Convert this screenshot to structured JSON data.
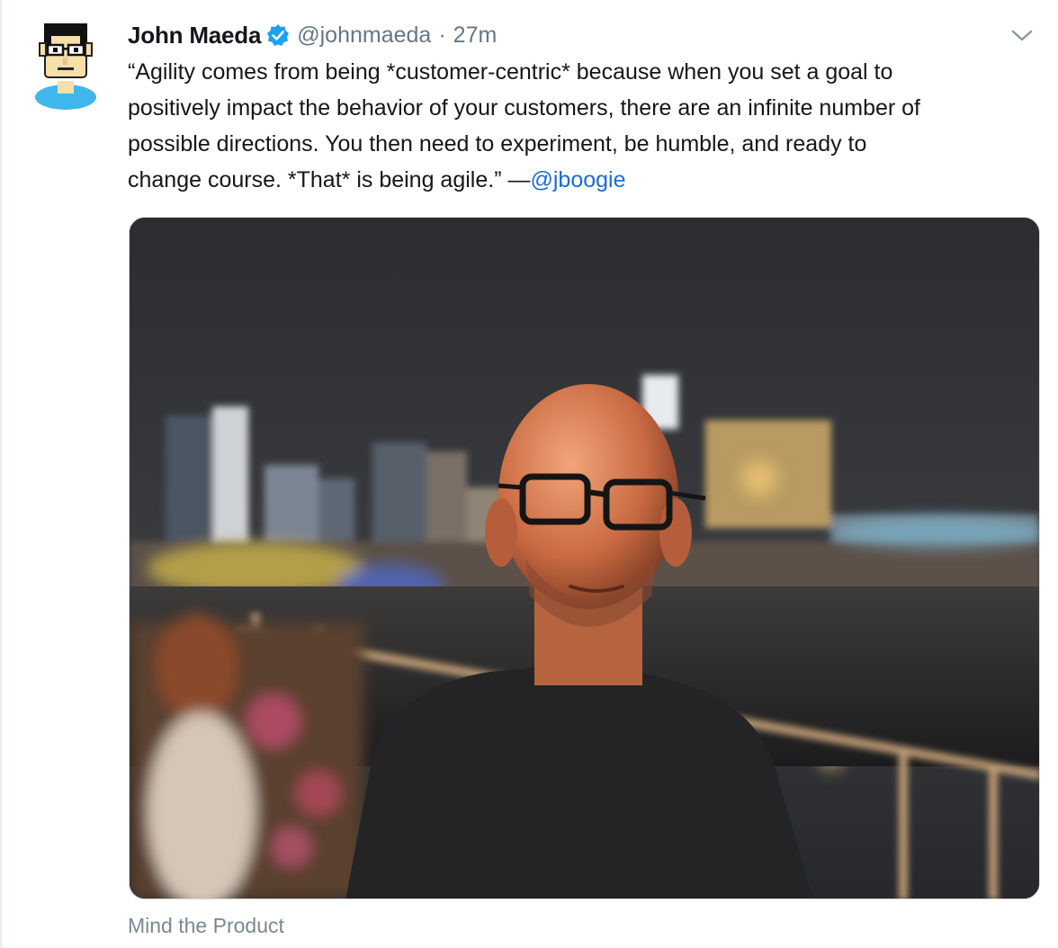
{
  "tweet": {
    "author_name": "John Maeda",
    "handle": "@johnmaeda",
    "separator": "·",
    "timestamp": "27m",
    "verified": true,
    "text_lines": [
      "“Agility comes from being *customer-centric* because when you set a goal to",
      "positively impact the behavior of your customers, there are an infinite number of",
      "possible directions. You then need to experiment, be humble, and ready to",
      "change course. *That* is being agile.” —"
    ],
    "mention": "@jboogie",
    "source_label": "Mind the Product",
    "icons": {
      "avatar": "pixel-cartoon-avatar",
      "verified": "verified-badge-icon",
      "menu": "chevron-down-icon"
    },
    "colors": {
      "text": "#14171a",
      "secondary": "#657786",
      "link": "#1b6bd8",
      "verified": "#1da1f2"
    }
  }
}
